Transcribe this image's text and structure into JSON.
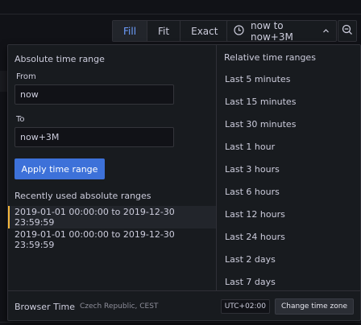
{
  "toolbar": {
    "zoom_modes": [
      "Fill",
      "Fit",
      "Exact"
    ],
    "active_zoom": "Fill",
    "time_range_label": "now to now+3M",
    "icons": [
      "clock-icon",
      "chevron-up-icon",
      "zoom-out-icon"
    ]
  },
  "absolute": {
    "title": "Absolute time range",
    "from_label": "From",
    "from_value": "now",
    "to_label": "To",
    "to_value": "now+3M",
    "apply_label": "Apply time range"
  },
  "recent": {
    "title": "Recently used absolute ranges",
    "items": [
      "2019-01-01 00:00:00 to 2019-12-30 23:59:59",
      "2019-01-01 00:00:00 to 2019-12-30 23:59:59"
    ]
  },
  "relative": {
    "title": "Relative time ranges",
    "items": [
      "Last 5 minutes",
      "Last 15 minutes",
      "Last 30 minutes",
      "Last 1 hour",
      "Last 3 hours",
      "Last 6 hours",
      "Last 12 hours",
      "Last 24 hours",
      "Last 2 days",
      "Last 7 days"
    ]
  },
  "footer": {
    "tz_name": "Browser Time",
    "tz_region": "Czech Republic, CEST",
    "tz_offset": "UTC+02:00",
    "change_tz_label": "Change time zone"
  },
  "colors": {
    "accent": "#3d71d9",
    "active_zoom": "#6e9fff",
    "selected_marker": "#f5b73d"
  }
}
